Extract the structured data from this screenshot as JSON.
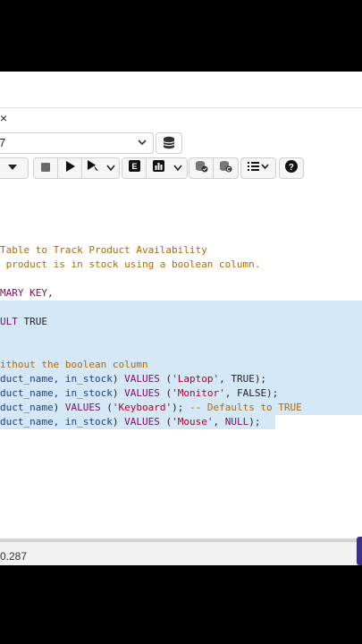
{
  "tab": {
    "close": "×"
  },
  "connection": {
    "value": "7",
    "chevron": "⌄"
  },
  "code_lines": [
    {
      "parts": [
        {
          "t": "Table to Track Product Availability",
          "c": "cm"
        }
      ]
    },
    {
      "parts": [
        {
          "t": " product is in stock using a boolean column.",
          "c": "cm"
        }
      ]
    },
    {
      "parts": [
        {
          "t": "MARY KEY",
          "c": "kw"
        },
        {
          "t": ",",
          "c": ""
        }
      ]
    },
    {
      "parts": [
        {
          "t": "ULT",
          "c": "kw"
        },
        {
          "t": " TRUE",
          "c": ""
        }
      ]
    },
    {
      "parts": [
        {
          "t": "ithout the boolean column",
          "c": "cm"
        }
      ]
    },
    {
      "parts": [
        {
          "t": "duct_name, in_stock",
          "c": "id"
        },
        {
          "t": ") ",
          "c": ""
        },
        {
          "t": "VALUES",
          "c": "kw"
        },
        {
          "t": " (",
          "c": ""
        },
        {
          "t": "'Laptop'",
          "c": "str"
        },
        {
          "t": ", TRUE);",
          "c": ""
        }
      ]
    },
    {
      "parts": [
        {
          "t": "duct_name, in_stock",
          "c": "id"
        },
        {
          "t": ") ",
          "c": ""
        },
        {
          "t": "VALUES",
          "c": "kw"
        },
        {
          "t": " (",
          "c": ""
        },
        {
          "t": "'Monitor'",
          "c": "str"
        },
        {
          "t": ", FALSE);",
          "c": ""
        }
      ]
    },
    {
      "parts": [
        {
          "t": "duct_name",
          "c": "id"
        },
        {
          "t": ") ",
          "c": ""
        },
        {
          "t": "VALUES",
          "c": "kw"
        },
        {
          "t": " (",
          "c": ""
        },
        {
          "t": "'Keyboard'",
          "c": "str"
        },
        {
          "t": "); ",
          "c": ""
        },
        {
          "t": "-- Defaults to TRUE",
          "c": "cm"
        }
      ]
    },
    {
      "parts": [
        {
          "t": "duct_name, in_stock",
          "c": "id"
        },
        {
          "t": ") ",
          "c": ""
        },
        {
          "t": "VALUES",
          "c": "kw"
        },
        {
          "t": " (",
          "c": ""
        },
        {
          "t": "'Mouse'",
          "c": "str"
        },
        {
          "t": ", ",
          "c": ""
        },
        {
          "t": "NULL",
          "c": "kw"
        },
        {
          "t": ");",
          "c": ""
        }
      ]
    }
  ],
  "status": {
    "text": "0.287"
  },
  "icons": [
    "close-icon",
    "chevron-down-icon",
    "database-icon",
    "stop-icon",
    "play-icon",
    "play-cursor-icon",
    "explain-icon",
    "chart-icon",
    "commit-icon",
    "rollback-icon",
    "list-icon",
    "help-icon"
  ]
}
